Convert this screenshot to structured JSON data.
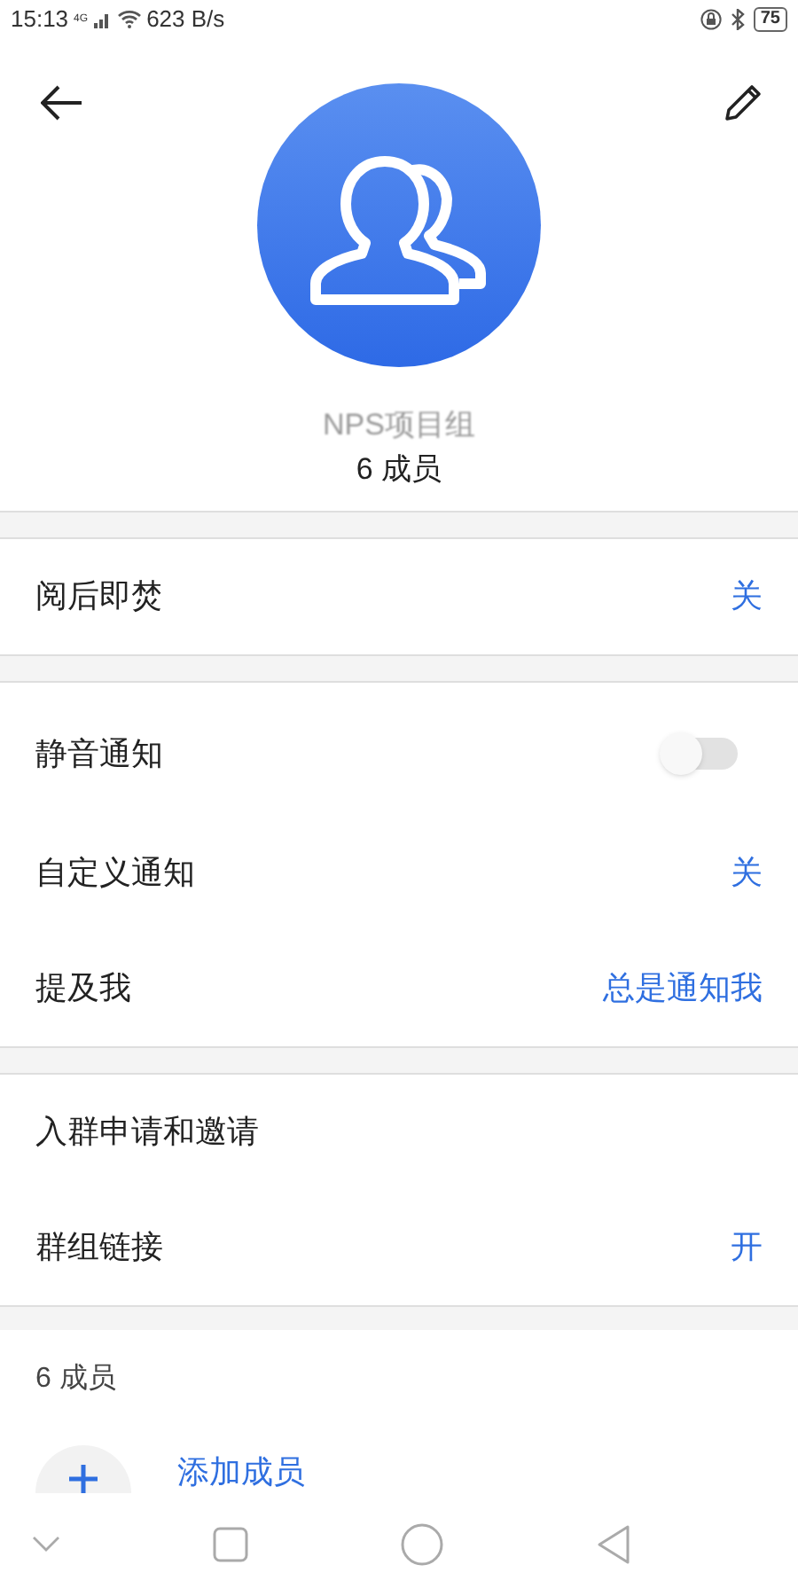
{
  "status_bar": {
    "time": "15:13",
    "network": "4G",
    "speed": "623 B/s",
    "battery": "75"
  },
  "group": {
    "name": "NPS项目组",
    "members": "6 成员"
  },
  "sections": [
    {
      "rows": [
        {
          "kind": "value",
          "label": "阅后即焚",
          "value": "关"
        }
      ]
    },
    {
      "rows": [
        {
          "kind": "toggle",
          "label": "静音通知",
          "on": false
        },
        {
          "kind": "value",
          "label": "自定义通知",
          "value": "关"
        },
        {
          "kind": "value",
          "label": "提及我",
          "value": "总是通知我"
        }
      ]
    },
    {
      "rows": [
        {
          "kind": "plain",
          "label": "入群申请和邀请"
        },
        {
          "kind": "value",
          "label": "群组链接",
          "value": "开"
        }
      ]
    }
  ],
  "members": {
    "title": "6 成员",
    "add_label": "添加成员"
  }
}
